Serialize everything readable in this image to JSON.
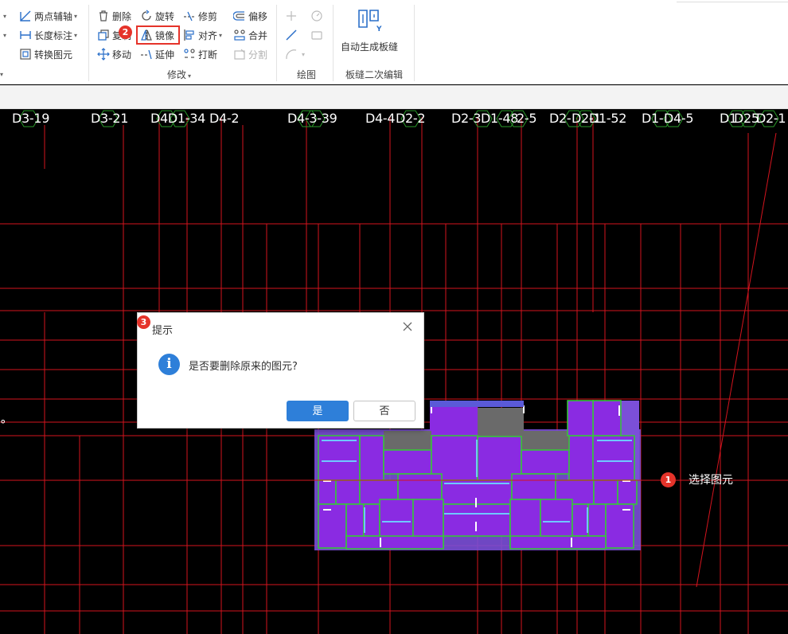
{
  "ribbon": {
    "group1": {
      "two_point_axis": "两点辅轴",
      "dimension": "长度标注",
      "convert_element": "转换图元"
    },
    "modify": {
      "delete": "删除",
      "rotate": "旋转",
      "trim": "修剪",
      "offset": "偏移",
      "copy": "复制",
      "mirror": "镜像",
      "align": "对齐",
      "merge": "合并",
      "move": "移动",
      "extend": "延伸",
      "break": "打断",
      "split": "分割",
      "group_label": "修改"
    },
    "draw": {
      "group_label": "绘图"
    },
    "slab_seam": {
      "auto_generate": "自动生成板缝",
      "group_label": "板缝二次编辑"
    }
  },
  "steps": {
    "s1": "1",
    "s2": "2",
    "s3": "3"
  },
  "canvas": {
    "axis_labels": [
      "D3-19",
      "D3-21",
      "D4D1-34",
      "D4-2",
      "D4-3-39",
      "D4-4",
      "D2-2",
      "D2-3",
      "D1-48",
      "2-5",
      "D2-",
      "D2-1",
      "D1-52",
      "D1-",
      "D4-5",
      "D1",
      "D25",
      "D2-1"
    ],
    "degree_mark": "°",
    "select_hint": "选择图元"
  },
  "dialog": {
    "title": "提示",
    "message": "是否要删除原来的图元?",
    "yes": "是",
    "no": "否"
  },
  "colors": {
    "grid": "#d4141e",
    "element_fill": "#8a2be2",
    "element_outline": "#33cc33",
    "primary_button": "#2e7fd9",
    "highlight": "#e5332a"
  }
}
